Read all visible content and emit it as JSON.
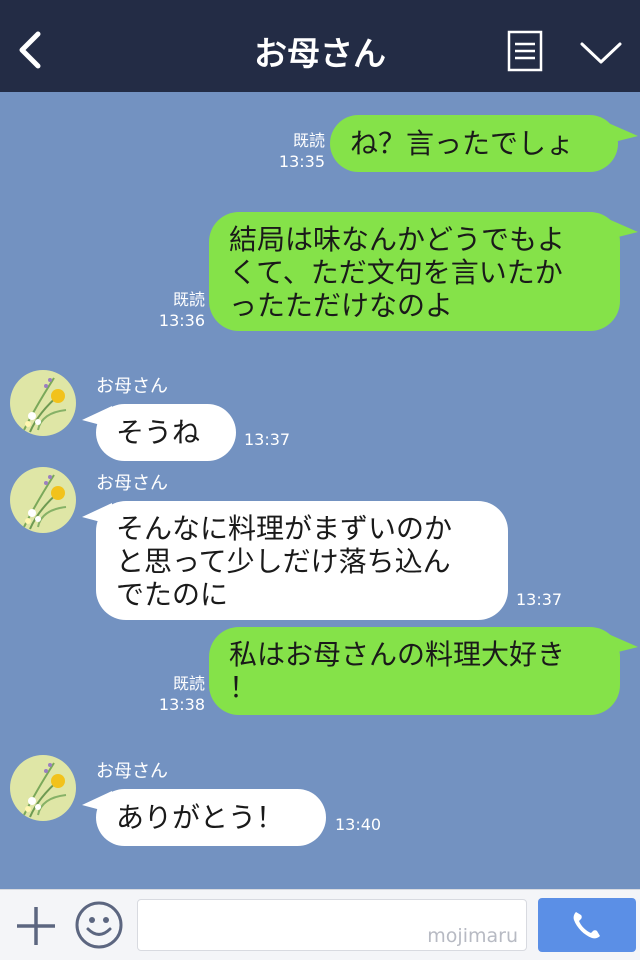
{
  "header": {
    "title": "お母さん",
    "icons": {
      "back": "chevron-left-icon",
      "menu": "note-menu-icon",
      "collapse": "chevron-down-icon"
    }
  },
  "messages": [
    {
      "side": "out",
      "text": "ね？言ったでしょ",
      "read": "既読",
      "time": "13:35"
    },
    {
      "side": "out",
      "text": "結局は味なんかどうでもよ\nくて、ただ文句を言いたか\nったただけなのよ",
      "read": "既読",
      "time": "13:36"
    },
    {
      "side": "in",
      "sender": "お母さん",
      "text": "そうね",
      "time": "13:37"
    },
    {
      "side": "in",
      "sender": "お母さん",
      "text": "そんなに料理がまずいのか\nと思って少しだけ落ち込ん\nでたのに",
      "time": "13:37"
    },
    {
      "side": "out",
      "text": "私はお母さんの料理大好き\n！",
      "read": "既読",
      "time": "13:38"
    },
    {
      "side": "in",
      "sender": "お母さん",
      "text": "ありがとう！",
      "time": "13:40"
    }
  ],
  "input": {
    "placeholder": "",
    "watermark": "mojimaru"
  },
  "colors": {
    "header_bg": "#232c45",
    "chat_bg": "#7392c1",
    "outgoing_bubble": "#85e249",
    "incoming_bubble": "#ffffff",
    "call_button": "#5b8fe6"
  }
}
